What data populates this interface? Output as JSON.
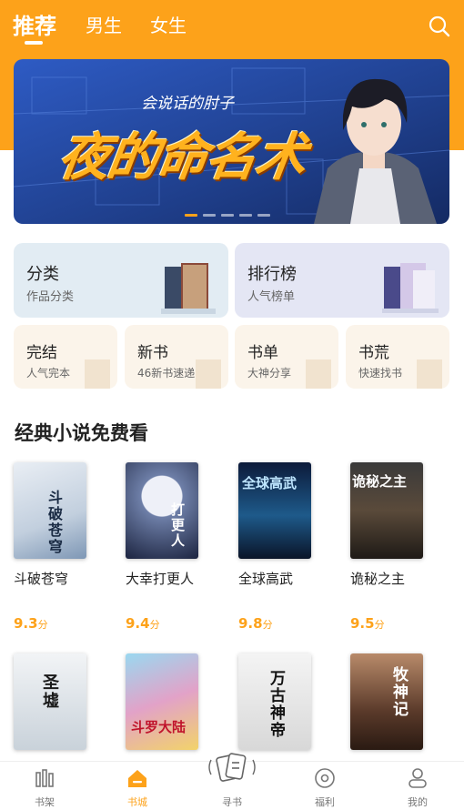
{
  "tabs": [
    {
      "label": "推荐",
      "active": true
    },
    {
      "label": "男生",
      "active": false
    },
    {
      "label": "女生",
      "active": false
    }
  ],
  "banner": {
    "author": "会说话的肘子",
    "title": "夜的命名术",
    "slide_count": 5,
    "active_slide": 1
  },
  "entries": [
    {
      "title": "分类",
      "sub": "作品分类"
    },
    {
      "title": "排行榜",
      "sub": "人气榜单"
    },
    {
      "title": "完结",
      "sub": "人气完本"
    },
    {
      "title": "新书",
      "sub": "46新书速递"
    },
    {
      "title": "书单",
      "sub": "大神分享"
    },
    {
      "title": "书荒",
      "sub": "快速找书"
    }
  ],
  "section": {
    "title": "经典小说免费看"
  },
  "books": [
    {
      "name": "斗破苍穹",
      "score": "9.3",
      "unit": "分",
      "cover_text": "斗破苍穹"
    },
    {
      "name": "大幸打更人",
      "score": "9.4",
      "unit": "分",
      "cover_text": "打更人"
    },
    {
      "name": "全球高武",
      "score": "9.8",
      "unit": "分",
      "cover_text": "全球高武"
    },
    {
      "name": "诡秘之主",
      "score": "9.5",
      "unit": "分",
      "cover_text": "诡秘之主"
    }
  ],
  "books_row2": [
    {
      "cover_text": "圣墟"
    },
    {
      "cover_text": "斗罗大陆"
    },
    {
      "cover_text": "万古神帝"
    },
    {
      "cover_text": "牧神记"
    }
  ],
  "bottom_nav": [
    {
      "label": "书架",
      "icon": "bookshelf-icon",
      "active": false
    },
    {
      "label": "书城",
      "icon": "bookstore-icon",
      "active": true
    },
    {
      "label": "寻书",
      "icon": "find-book-icon",
      "active": false
    },
    {
      "label": "福利",
      "icon": "welfare-icon",
      "active": false
    },
    {
      "label": "我的",
      "icon": "profile-icon",
      "active": false
    }
  ],
  "colors": {
    "accent": "#FDA21A",
    "banner_bg": "#1F3F8C"
  }
}
